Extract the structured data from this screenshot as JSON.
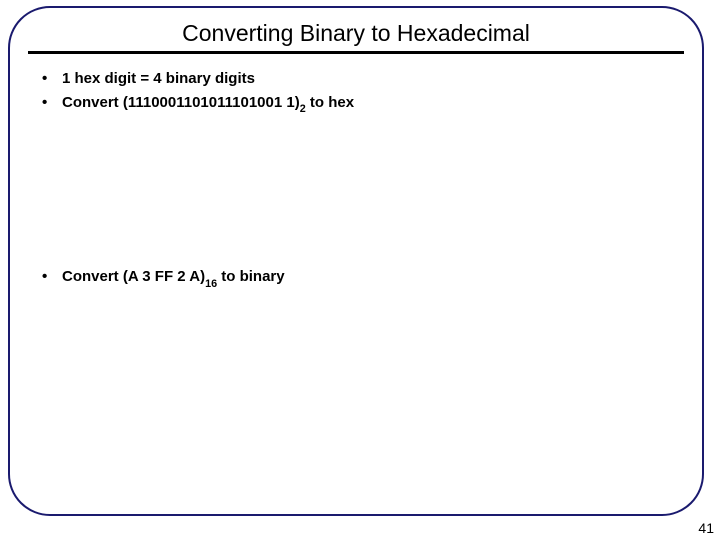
{
  "slide": {
    "title": "Converting Binary to Hexadecimal",
    "bullets": {
      "b1": "1 hex digit = 4 binary digits",
      "b2_pre": "Convert (1110001101011101001 1)",
      "b2_sub": "2",
      "b2_post": " to hex",
      "b3_pre": "Convert (A 3 FF 2 A)",
      "b3_sub": "16",
      "b3_post": " to binary"
    },
    "page_number": "41"
  }
}
